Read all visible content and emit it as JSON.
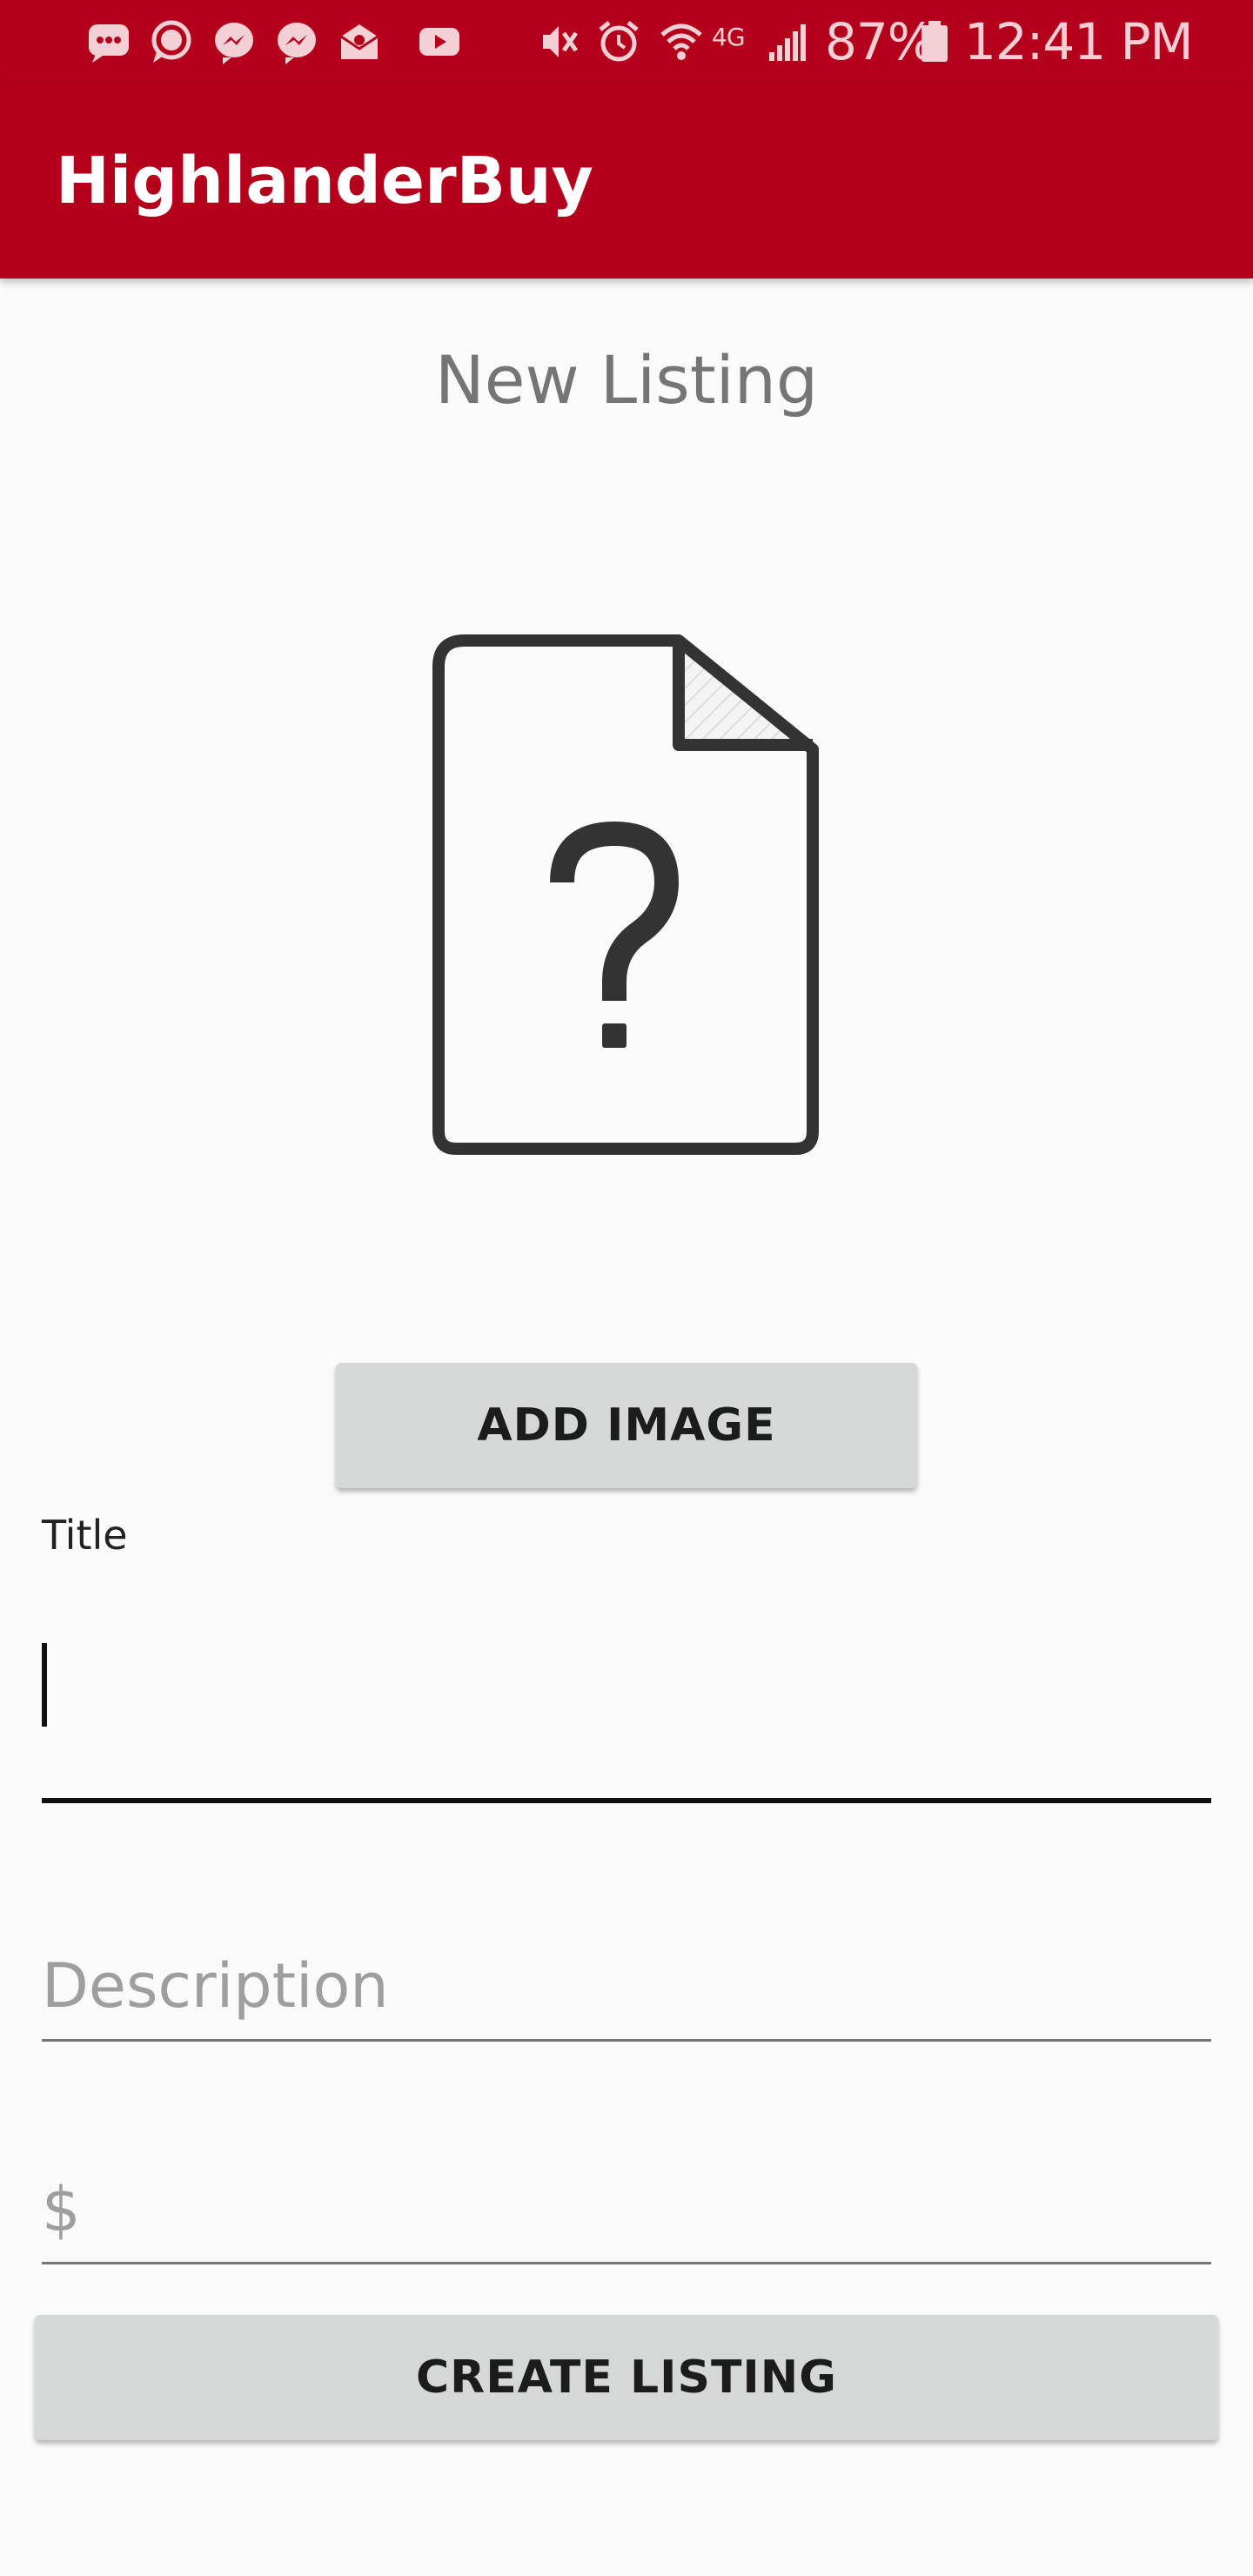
{
  "status_bar": {
    "battery_percent": "87%",
    "time": "12:41 PM",
    "network_label": "4G",
    "left_icons": [
      "messages-icon",
      "chat-bubble-icon",
      "messenger-icon",
      "messenger-icon",
      "mail-icon",
      "youtube-icon"
    ],
    "right_icons": [
      "vibrate-mute-icon",
      "alarm-icon",
      "wifi-icon",
      "signal-icon",
      "battery-icon"
    ]
  },
  "app_bar": {
    "title": "HighlanderBuy",
    "color": "#b5001c"
  },
  "form": {
    "heading": "New Listing",
    "image_placeholder_icon": "unknown-file-icon",
    "add_image_label": "ADD IMAGE",
    "title_label": "Title",
    "title_value": "",
    "description_placeholder": "Description",
    "price_placeholder": "$",
    "create_label": "CREATE LISTING"
  }
}
